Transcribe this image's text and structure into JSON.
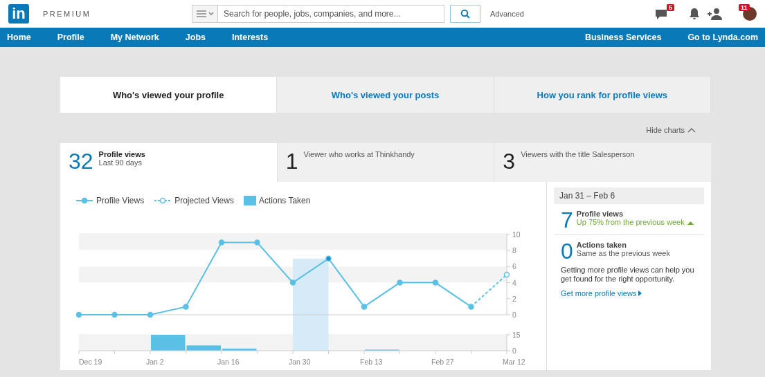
{
  "header": {
    "logo": "in",
    "brand": "PREMIUM",
    "search": {
      "placeholder": "Search for people, jobs, companies, and more..."
    },
    "advanced": "Advanced",
    "messages_badge": "5",
    "invites_badge": "11"
  },
  "nav": {
    "left": [
      {
        "label": "Home"
      },
      {
        "label": "Profile"
      },
      {
        "label": "My Network"
      },
      {
        "label": "Jobs"
      },
      {
        "label": "Interests"
      }
    ],
    "right": [
      {
        "label": "Business Services"
      },
      {
        "label": "Go to Lynda.com"
      }
    ]
  },
  "tabs": [
    {
      "label": "Who's viewed your profile",
      "selected": true
    },
    {
      "label": "Who's viewed your posts",
      "selected": false
    },
    {
      "label": "How you rank for profile views",
      "selected": false
    }
  ],
  "hide_charts": "Hide charts",
  "stats": [
    {
      "number": "32",
      "title": "Profile views",
      "subtitle": "Last 90 days",
      "selected": true
    },
    {
      "number": "1",
      "title": "Viewer who works at Thinkhandy",
      "selected": false
    },
    {
      "number": "3",
      "title": "Viewers with the title Salesperson",
      "selected": false
    }
  ],
  "chart": {
    "main": {
      "chart_data": {
        "type": "line",
        "categories": [
          "Dec 19",
          null,
          "Jan 2",
          null,
          "Jan 16",
          null,
          "Jan 30",
          null,
          "Feb 13",
          null,
          "Feb 27",
          null,
          "Mar 12"
        ],
        "ylim": [
          0,
          10
        ],
        "yticks": [
          0,
          2,
          4,
          6,
          8,
          10
        ],
        "series": [
          {
            "name": "Profile Views",
            "color": "#5bc0e5",
            "marker": "circle",
            "line_style": "solid",
            "values": [
              0,
              0,
              0,
              1,
              9,
              9,
              4,
              7,
              1,
              4,
              4,
              1,
              null
            ]
          },
          {
            "name": "Projected Views",
            "color": "#5bc0e5",
            "marker": "open_circle",
            "line_style": "dashed",
            "values": [
              null,
              null,
              null,
              null,
              null,
              null,
              null,
              null,
              null,
              null,
              null,
              1,
              5
            ]
          }
        ]
      }
    },
    "actions": {
      "chart_data": {
        "type": "bar",
        "ylim": [
          0,
          15
        ],
        "yticks": [
          0,
          15
        ],
        "series": [
          {
            "name": "Actions Taken",
            "color": "#5bc0e5",
            "values": [
              0,
              0,
              15,
              5,
              2,
              0,
              0,
              0,
              1,
              0,
              0,
              0
            ]
          }
        ]
      }
    }
  },
  "week_panel": {
    "range": "Jan 31 – Feb 6",
    "stats": [
      {
        "number": "7",
        "title": "Profile views",
        "note": "Up 75% from the previous week",
        "rising": true
      },
      {
        "number": "0",
        "title": "Actions taken",
        "note": "Same as the previous week",
        "rising": false
      }
    ],
    "tip": "Getting more profile views can help you get found for the right opportunity.",
    "link": "Get more profile views"
  }
}
